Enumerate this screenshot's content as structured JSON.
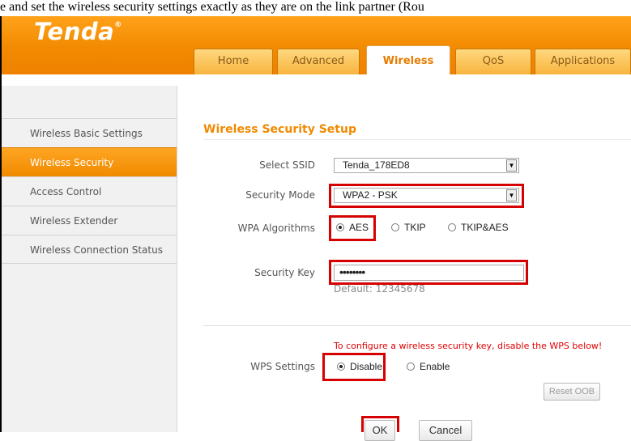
{
  "caption": "e and set the wireless security settings exactly as they are on the link partner (Rou",
  "header": {
    "logo": "Tenda",
    "logo_mark": "®",
    "tabs": [
      "Home",
      "Advanced",
      "Wireless",
      "QoS",
      "Applications"
    ],
    "active_tab": "Wireless"
  },
  "sidebar": {
    "items": [
      {
        "label": "Wireless Basic Settings"
      },
      {
        "label": "Wireless Security"
      },
      {
        "label": "Access Control"
      },
      {
        "label": "Wireless Extender"
      },
      {
        "label": "Wireless Connection Status"
      }
    ],
    "active_item": "Wireless Security"
  },
  "main": {
    "title": "Wireless Security Setup",
    "select_ssid": {
      "label": "Select SSID",
      "value": "Tenda_178ED8"
    },
    "security_mode": {
      "label": "Security Mode",
      "value": "WPA2 - PSK"
    },
    "wpa_algorithms": {
      "label": "WPA Algorithms",
      "options": [
        "AES",
        "TKIP",
        "TKIP&AES"
      ],
      "selected": "AES"
    },
    "security_key": {
      "label": "Security Key",
      "value": "••••••••",
      "default_text": "Default: 12345678"
    },
    "wps_note": "To configure a wireless security key, disable the WPS below!",
    "wps_settings": {
      "label": "WPS Settings",
      "options": [
        "Disable",
        "Enable"
      ],
      "selected": "Disable"
    },
    "reset_oob_label": "Reset OOB",
    "ok_label": "OK",
    "cancel_label": "Cancel"
  },
  "colors": {
    "brand_orange": "#f08a00",
    "highlight_red": "#d60000",
    "note_red": "#e00000"
  }
}
